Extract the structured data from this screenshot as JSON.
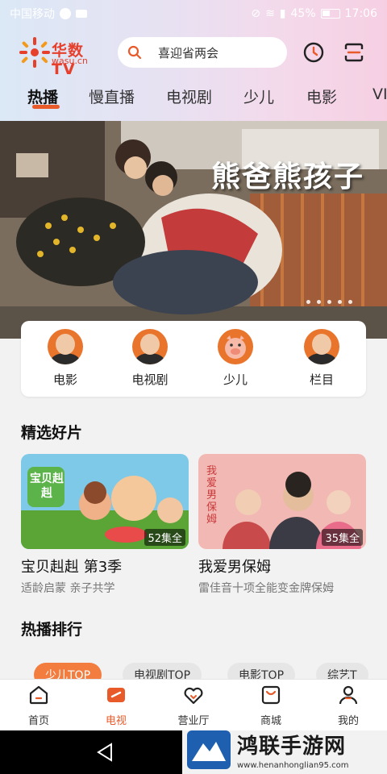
{
  "status_bar": {
    "carrier": "中国移动",
    "battery": "45%",
    "time": "17:06"
  },
  "header": {
    "logo_name": "华数TV",
    "logo_domain": "wasu.cn",
    "search_placeholder": "喜迎省两会"
  },
  "tabs": [
    {
      "label": "热播",
      "active": true
    },
    {
      "label": "慢直播",
      "active": false
    },
    {
      "label": "电视剧",
      "active": false
    },
    {
      "label": "少儿",
      "active": false
    },
    {
      "label": "电影",
      "active": false
    },
    {
      "label": "VI",
      "active": false
    }
  ],
  "banner": {
    "title": "熊爸熊孩子",
    "page_count": 5
  },
  "categories": [
    {
      "label": "电影",
      "icon": "movie-avatar"
    },
    {
      "label": "电视剧",
      "icon": "tv-drama-avatar"
    },
    {
      "label": "少儿",
      "icon": "pig-avatar"
    },
    {
      "label": "栏目",
      "icon": "column-avatar"
    }
  ],
  "sections": {
    "picks_title": "精选好片",
    "ranking_title": "热播排行"
  },
  "picks": [
    {
      "title": "宝贝赳赳 第3季",
      "subtitle": "适龄启蒙 亲子共学",
      "badge": "52集全",
      "thumb_text": "宝贝赳赳"
    },
    {
      "title": "我爱男保姆",
      "subtitle": "雷佳音十项全能变金牌保姆",
      "badge": "35集全",
      "thumb_text": "我爱男保姆"
    }
  ],
  "ranking_pills": [
    {
      "label": "少儿TOP",
      "active": true
    },
    {
      "label": "电视剧TOP",
      "active": false
    },
    {
      "label": "电影TOP",
      "active": false
    },
    {
      "label": "综艺T",
      "active": false
    }
  ],
  "bottom_nav": [
    {
      "label": "首页",
      "icon": "home-icon",
      "active": false
    },
    {
      "label": "电视",
      "icon": "tv-icon",
      "active": true
    },
    {
      "label": "营业厅",
      "icon": "heart-icon",
      "active": false
    },
    {
      "label": "商城",
      "icon": "shop-icon",
      "active": false
    },
    {
      "label": "我的",
      "icon": "user-icon",
      "active": false
    }
  ],
  "watermark": {
    "name": "鸿联手游网",
    "url": "www.henanhonglian95.com"
  },
  "colors": {
    "accent": "#e85a2a",
    "logo": "#e63f2b",
    "pill_active": "#f27d3f"
  }
}
